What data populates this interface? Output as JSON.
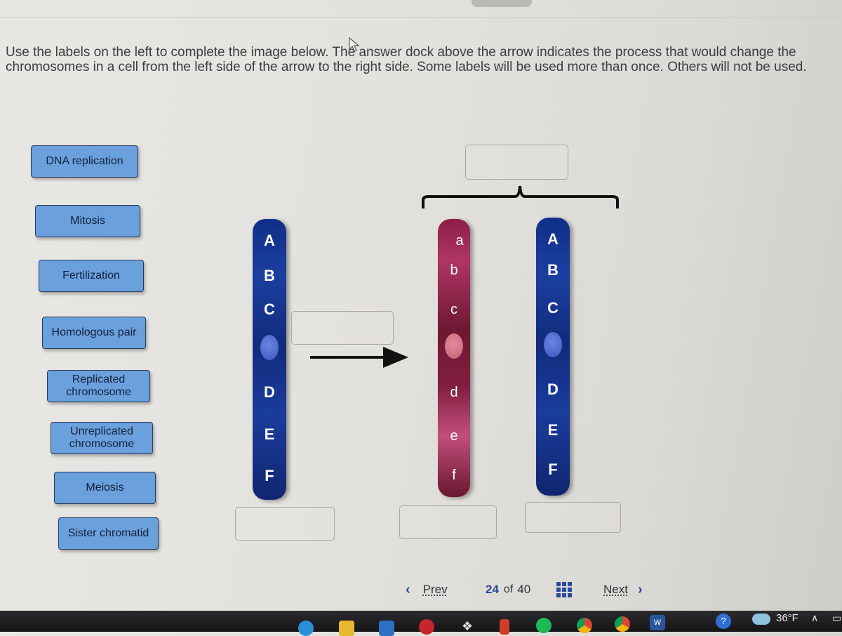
{
  "instructions": "Use the labels on the left to complete the image below. The answer dock above the arrow indicates the process that would change the chromosomes in a cell from the left side of the arrow to the right side. Some labels will be used more than once. Others will not be used.",
  "labels": [
    {
      "id": "dna-replication",
      "text": "DNA replication"
    },
    {
      "id": "mitosis",
      "text": "Mitosis"
    },
    {
      "id": "fertilization",
      "text": "Fertilization"
    },
    {
      "id": "homologous-pair",
      "text": "Homologous pair"
    },
    {
      "id": "replicated-chromosome",
      "text": "Replicated chromosome"
    },
    {
      "id": "unreplicated-chromosome",
      "text": "Unreplicated chromosome"
    },
    {
      "id": "meiosis",
      "text": "Meiosis"
    },
    {
      "id": "sister-chromatid",
      "text": "Sister chromatid"
    }
  ],
  "docks": {
    "arrow_process": "",
    "bracket_top": "",
    "left_chromosome": "",
    "middle_chromosome": "",
    "right_chromosome": ""
  },
  "chromosomes": {
    "left": {
      "color": "#1b3fa0",
      "genes_upper": [
        "A",
        "B",
        "C"
      ],
      "genes_lower": [
        "D",
        "E",
        "F"
      ]
    },
    "middle": {
      "color": "#8a1f47",
      "genes_upper": [
        "a",
        "b",
        "c"
      ],
      "genes_lower": [
        "d",
        "e",
        "f"
      ]
    },
    "right": {
      "color": "#1b3fa0",
      "genes_upper": [
        "A",
        "B",
        "C"
      ],
      "genes_lower": [
        "D",
        "E",
        "F"
      ]
    }
  },
  "navigation": {
    "prev_label": "Prev",
    "current": "24",
    "of_label": "of",
    "total": "40",
    "next_label": "Next"
  },
  "taskbar": {
    "weather_temp": "36°F",
    "apps": [
      "edge",
      "file-explorer",
      "mail",
      "app-red",
      "dropbox",
      "office",
      "spotify",
      "chrome",
      "chrome-profile",
      "word"
    ]
  }
}
